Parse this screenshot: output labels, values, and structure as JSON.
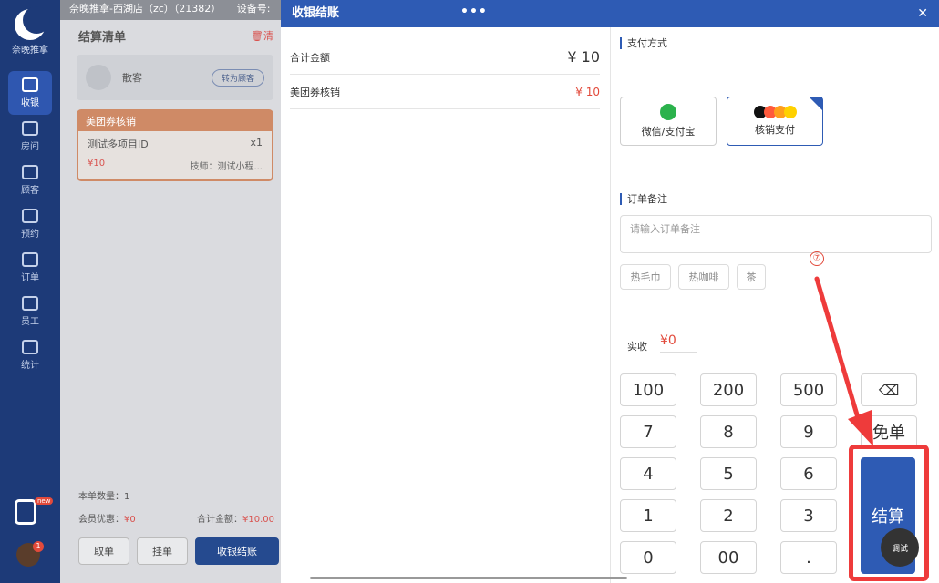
{
  "sidebar": {
    "logo_text": "奈晚推拿",
    "items": [
      {
        "label": "收银",
        "icon": "monitor-icon"
      },
      {
        "label": "房间",
        "icon": "house-icon"
      },
      {
        "label": "顾客",
        "icon": "user-icon"
      },
      {
        "label": "预约",
        "icon": "calendar-icon"
      },
      {
        "label": "订单",
        "icon": "clipboard-icon"
      },
      {
        "label": "员工",
        "icon": "people-icon"
      },
      {
        "label": "统计",
        "icon": "chart-icon"
      }
    ],
    "badge_tag": "new",
    "avatar_badge": "1"
  },
  "main": {
    "store": "奈晚推拿-西湖店（zc）（21382）",
    "device_label": "设备号:",
    "list_title": "结算清单",
    "clear_label": "清",
    "customer_name": "散客",
    "to_member_label": "转为顾客",
    "coupon_header": "美团券核销",
    "item_name": "测试多项目ID",
    "item_qty": "x1",
    "item_price": "¥10",
    "item_tech": "技师：测试小程...",
    "summary": {
      "count_label": "本单数量：1",
      "member_discount_label": "会员优惠：",
      "member_discount_value": "¥0",
      "total_label": "合计金额：",
      "total_value": "¥10.00"
    },
    "actions": {
      "cancel": "取单",
      "hold": "挂单",
      "checkout": "收银结账"
    }
  },
  "modal": {
    "title": "收银结账",
    "dots": "•••",
    "close": "✕",
    "total_label": "合计金额",
    "total_value": "¥ 10",
    "meituan_label": "美团券核销",
    "meituan_value": "¥ 10",
    "payment_title": "支付方式",
    "pay_wechat": "微信/支付宝",
    "pay_verify": "核销支付",
    "remark_title": "订单备注",
    "remark_placeholder": "请输入订单备注",
    "tags": [
      "热毛巾",
      "热咖啡",
      "茶"
    ],
    "step_marker": "⑦",
    "received_label": "实收",
    "received_value": "¥0",
    "keys": [
      "100",
      "200",
      "500",
      "7",
      "8",
      "9",
      "4",
      "5",
      "6",
      "1",
      "2",
      "3",
      "0",
      "00",
      "."
    ],
    "backspace_label": "⌫",
    "waive_label": "免单",
    "settle_label": "结算",
    "debug_label": "调试"
  },
  "colors": {
    "primary": "#2e5bb4",
    "sidebar": "#1d3a78",
    "accent_red": "#e24a3b",
    "highlight": "#ee3b3b"
  }
}
